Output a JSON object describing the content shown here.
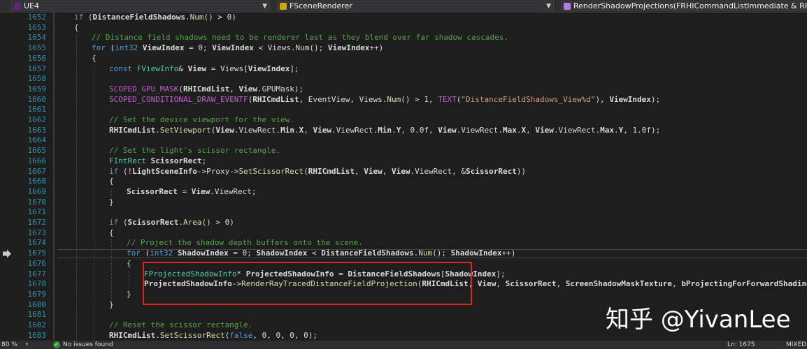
{
  "nav": {
    "project": "UE4",
    "class_scope": "FSceneRenderer",
    "member_scope": "RenderShadowProjections(FRHICommandListImmediate & RHICmdList, co"
  },
  "colors": {
    "background": "#1e1e1e",
    "line_number": "#2b91af",
    "keyword": "#569cd6",
    "type": "#4ec9b0",
    "comment": "#57a64a",
    "string": "#d69d85",
    "macro": "#bd63c5",
    "function": "#dcdcaa",
    "text": "#dcdcdc",
    "highlight_box": "#e0241b"
  },
  "editor": {
    "current_line": 1675,
    "lines": [
      {
        "n": "1652",
        "i": 1,
        "t": [
          {
            "k": "kw",
            "v": "if"
          },
          {
            "v": " ("
          },
          {
            "k": "bd",
            "v": "DistanceFieldShadows"
          },
          {
            "v": "."
          },
          {
            "k": "fn",
            "v": "Num"
          },
          {
            "v": "() > 0)"
          }
        ]
      },
      {
        "n": "1653",
        "i": 1,
        "t": [
          {
            "v": "{"
          }
        ]
      },
      {
        "n": "1654",
        "i": 2,
        "t": [
          {
            "k": "cm",
            "v": "// Distance field shadows need to be renderer last as they blend over far shadow cascades."
          }
        ]
      },
      {
        "n": "1655",
        "i": 2,
        "t": [
          {
            "k": "kw",
            "v": "for"
          },
          {
            "v": " ("
          },
          {
            "k": "kw",
            "v": "int32"
          },
          {
            "v": " "
          },
          {
            "k": "bd",
            "v": "ViewIndex"
          },
          {
            "v": " = 0; "
          },
          {
            "k": "bd",
            "v": "ViewIndex"
          },
          {
            "v": " < Views."
          },
          {
            "k": "fn",
            "v": "Num"
          },
          {
            "v": "(); "
          },
          {
            "k": "bd",
            "v": "ViewIndex"
          },
          {
            "v": "++)"
          }
        ]
      },
      {
        "n": "1656",
        "i": 2,
        "t": [
          {
            "v": "{"
          }
        ]
      },
      {
        "n": "1657",
        "i": 3,
        "t": [
          {
            "k": "kw",
            "v": "const"
          },
          {
            "v": " "
          },
          {
            "k": "ty",
            "v": "FViewInfo"
          },
          {
            "v": "& "
          },
          {
            "k": "bd",
            "v": "View"
          },
          {
            "v": " = Views["
          },
          {
            "k": "bd",
            "v": "ViewIndex"
          },
          {
            "v": "];"
          }
        ]
      },
      {
        "n": "1658",
        "i": 3,
        "t": []
      },
      {
        "n": "1659",
        "i": 3,
        "t": [
          {
            "k": "mc",
            "v": "SCOPED_GPU_MASK"
          },
          {
            "v": "("
          },
          {
            "k": "bd",
            "v": "RHICmdList"
          },
          {
            "v": ", "
          },
          {
            "k": "bd",
            "v": "View"
          },
          {
            "v": ".GPUMask);"
          }
        ]
      },
      {
        "n": "1660",
        "i": 3,
        "t": [
          {
            "k": "mc",
            "v": "SCOPED_CONDITIONAL_DRAW_EVENTF"
          },
          {
            "v": "("
          },
          {
            "k": "bd",
            "v": "RHICmdList"
          },
          {
            "v": ", EventView, Views."
          },
          {
            "k": "fn",
            "v": "Num"
          },
          {
            "v": "() > 1, "
          },
          {
            "k": "mc",
            "v": "TEXT"
          },
          {
            "v": "("
          },
          {
            "k": "st",
            "v": "\"DistanceFieldShadows_View%d\""
          },
          {
            "v": "), "
          },
          {
            "k": "bd",
            "v": "ViewIndex"
          },
          {
            "v": ");"
          }
        ]
      },
      {
        "n": "1661",
        "i": 3,
        "t": []
      },
      {
        "n": "1662",
        "i": 3,
        "t": [
          {
            "k": "cm",
            "v": "// Set the device viewport for the view."
          }
        ]
      },
      {
        "n": "1663",
        "i": 3,
        "t": [
          {
            "k": "bd",
            "v": "RHICmdList"
          },
          {
            "v": "."
          },
          {
            "k": "fn",
            "v": "SetViewport"
          },
          {
            "v": "("
          },
          {
            "k": "bd",
            "v": "View"
          },
          {
            "v": ".ViewRect."
          },
          {
            "k": "bd",
            "v": "Min"
          },
          {
            "v": "."
          },
          {
            "k": "bd",
            "v": "X"
          },
          {
            "v": ", "
          },
          {
            "k": "bd",
            "v": "View"
          },
          {
            "v": ".ViewRect."
          },
          {
            "k": "bd",
            "v": "Min"
          },
          {
            "v": "."
          },
          {
            "k": "bd",
            "v": "Y"
          },
          {
            "v": ", 0.0f, "
          },
          {
            "k": "bd",
            "v": "View"
          },
          {
            "v": ".ViewRect."
          },
          {
            "k": "bd",
            "v": "Max"
          },
          {
            "v": "."
          },
          {
            "k": "bd",
            "v": "X"
          },
          {
            "v": ", "
          },
          {
            "k": "bd",
            "v": "View"
          },
          {
            "v": ".ViewRect."
          },
          {
            "k": "bd",
            "v": "Max"
          },
          {
            "v": "."
          },
          {
            "k": "bd",
            "v": "Y"
          },
          {
            "v": ", 1.0f);"
          }
        ]
      },
      {
        "n": "1664",
        "i": 3,
        "t": []
      },
      {
        "n": "1665",
        "i": 3,
        "t": [
          {
            "k": "cm",
            "v": "// Set the light's scissor rectangle."
          }
        ]
      },
      {
        "n": "1666",
        "i": 3,
        "t": [
          {
            "k": "ty",
            "v": "FIntRect"
          },
          {
            "v": " "
          },
          {
            "k": "bd",
            "v": "ScissorRect"
          },
          {
            "v": ";"
          }
        ]
      },
      {
        "n": "1667",
        "i": 3,
        "t": [
          {
            "k": "kw",
            "v": "if"
          },
          {
            "v": " (!"
          },
          {
            "k": "bd",
            "v": "LightSceneInfo"
          },
          {
            "v": "->Proxy->"
          },
          {
            "k": "fn",
            "v": "SetScissorRect"
          },
          {
            "v": "("
          },
          {
            "k": "bd",
            "v": "RHICmdList"
          },
          {
            "v": ", "
          },
          {
            "k": "bd",
            "v": "View"
          },
          {
            "v": ", "
          },
          {
            "k": "bd",
            "v": "View"
          },
          {
            "v": ".ViewRect, &"
          },
          {
            "k": "bd",
            "v": "ScissorRect"
          },
          {
            "v": "))"
          }
        ]
      },
      {
        "n": "1668",
        "i": 3,
        "t": [
          {
            "v": "{"
          }
        ]
      },
      {
        "n": "1669",
        "i": 4,
        "t": [
          {
            "k": "bd",
            "v": "ScissorRect"
          },
          {
            "v": " = "
          },
          {
            "k": "bd",
            "v": "View"
          },
          {
            "v": ".ViewRect;"
          }
        ]
      },
      {
        "n": "1670",
        "i": 3,
        "t": [
          {
            "v": "}"
          }
        ]
      },
      {
        "n": "1671",
        "i": 3,
        "t": []
      },
      {
        "n": "1672",
        "i": 3,
        "t": [
          {
            "k": "kw",
            "v": "if"
          },
          {
            "v": " ("
          },
          {
            "k": "bd",
            "v": "ScissorRect"
          },
          {
            "v": "."
          },
          {
            "k": "fn",
            "v": "Area"
          },
          {
            "v": "() > 0)"
          }
        ]
      },
      {
        "n": "1673",
        "i": 3,
        "t": [
          {
            "v": "{"
          }
        ]
      },
      {
        "n": "1674",
        "i": 4,
        "t": [
          {
            "k": "cm",
            "v": "// Project the shadow depth buffers onto the scene."
          }
        ]
      },
      {
        "n": "1675",
        "i": 4,
        "t": [
          {
            "k": "kw",
            "v": "for"
          },
          {
            "v": " ("
          },
          {
            "k": "kw",
            "v": "int32"
          },
          {
            "v": " "
          },
          {
            "k": "bd",
            "v": "ShadowIndex"
          },
          {
            "v": " = 0; "
          },
          {
            "k": "bd",
            "v": "ShadowIndex"
          },
          {
            "v": " < "
          },
          {
            "k": "bd",
            "v": "DistanceFieldShadows"
          },
          {
            "v": "."
          },
          {
            "k": "fn",
            "v": "Num"
          },
          {
            "v": "(); "
          },
          {
            "k": "bd",
            "v": "ShadowIndex"
          },
          {
            "v": "++)"
          }
        ]
      },
      {
        "n": "1676",
        "i": 4,
        "t": [
          {
            "v": "{"
          }
        ]
      },
      {
        "n": "1677",
        "i": 5,
        "t": [
          {
            "k": "ty",
            "v": "FProjectedShadowInfo"
          },
          {
            "v": "* "
          },
          {
            "k": "bd",
            "v": "ProjectedShadowInfo"
          },
          {
            "v": " = "
          },
          {
            "k": "bd",
            "v": "DistanceFieldShadows"
          },
          {
            "v": "["
          },
          {
            "k": "bd",
            "v": "ShadowIndex"
          },
          {
            "v": "];"
          }
        ]
      },
      {
        "n": "1678",
        "i": 5,
        "t": [
          {
            "k": "bd",
            "v": "ProjectedShadowInfo"
          },
          {
            "v": "->"
          },
          {
            "k": "fn",
            "v": "RenderRayTracedDistanceFieldProjection"
          },
          {
            "v": "("
          },
          {
            "k": "bd",
            "v": "RHICmdList"
          },
          {
            "v": ", "
          },
          {
            "k": "bd",
            "v": "View"
          },
          {
            "v": ", "
          },
          {
            "k": "bd",
            "v": "ScissorRect"
          },
          {
            "v": ", "
          },
          {
            "k": "bd",
            "v": "ScreenShadowMaskTexture"
          },
          {
            "v": ", "
          },
          {
            "k": "bd",
            "v": "bProjectingForForwardShading"
          },
          {
            "v": ");"
          }
        ]
      },
      {
        "n": "1679",
        "i": 4,
        "t": [
          {
            "v": "}"
          }
        ]
      },
      {
        "n": "1680",
        "i": 3,
        "t": [
          {
            "v": "}"
          }
        ]
      },
      {
        "n": "1681",
        "i": 3,
        "t": []
      },
      {
        "n": "1682",
        "i": 3,
        "t": [
          {
            "k": "cm",
            "v": "// Reset the scissor rectangle."
          }
        ]
      },
      {
        "n": "1683",
        "i": 3,
        "t": [
          {
            "k": "bd",
            "v": "RHICmdList"
          },
          {
            "v": "."
          },
          {
            "k": "fn",
            "v": "SetScissorRect"
          },
          {
            "v": "("
          },
          {
            "k": "kw",
            "v": "false"
          },
          {
            "v": ", 0, 0, 0, 0);"
          }
        ]
      }
    ]
  },
  "status": {
    "zoom": "80 %",
    "issues": "No issues found",
    "position": "Ln: 1675",
    "line_ending": "MIXED"
  },
  "watermark": "知乎 @YivanLee"
}
